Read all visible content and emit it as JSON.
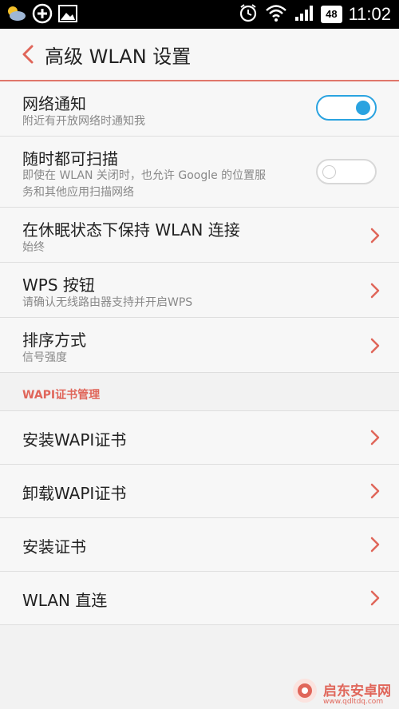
{
  "status_bar": {
    "time": "11:02",
    "battery": "48",
    "icons": [
      "weather-icon",
      "add-circle-icon",
      "image-icon",
      "alarm-icon",
      "wifi-icon",
      "signal-icon"
    ]
  },
  "header": {
    "title": "高级 WLAN 设置"
  },
  "settings": {
    "network_notify": {
      "title": "网络通知",
      "subtitle": "附近有开放网络时通知我",
      "enabled": true
    },
    "always_scan": {
      "title": "随时都可扫描",
      "subtitle_line1": "即使在 WLAN 关闭时，也允许 Google 的位置服",
      "subtitle_line2": "务和其他应用扫描网络",
      "enabled": false
    },
    "keep_wlan_sleep": {
      "title": "在休眠状态下保持 WLAN 连接",
      "subtitle": "始终"
    },
    "wps_button": {
      "title": "WPS 按钮",
      "subtitle": "请确认无线路由器支持并开启WPS"
    },
    "sort_by": {
      "title": "排序方式",
      "subtitle": "信号强度"
    }
  },
  "wapi_section": {
    "label": "WAPI证书管理",
    "items": [
      {
        "title": "安装WAPI证书"
      },
      {
        "title": "卸载WAPI证书"
      },
      {
        "title": "安装证书"
      },
      {
        "title": "WLAN 直连"
      }
    ]
  },
  "watermark": {
    "name": "启东安卓网",
    "url": "www.qdltdq.com"
  },
  "colors": {
    "accent": "#e0665a",
    "toggle_on": "#2aa3e0",
    "status_bar": "#000000"
  }
}
